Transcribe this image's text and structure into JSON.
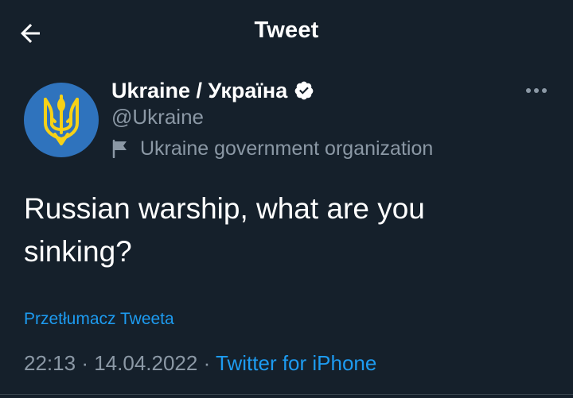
{
  "header": {
    "title": "Tweet",
    "back_icon": "arrow-left-icon"
  },
  "tweet": {
    "author": {
      "display_name": "Ukraine / Україна",
      "handle": "@Ukraine",
      "verified": true,
      "affiliation_label": "Ukraine government organization",
      "avatar_icon": "trident-coat-of-arms-icon"
    },
    "text_line1": "Russian warship, what are you",
    "text_line2": "sinking?",
    "translate_link": "Przetłumacz Tweeta",
    "time": "22:13",
    "separator": "·",
    "date": "14.04.2022",
    "source": "Twitter for iPhone"
  },
  "colors": {
    "background": "#15202b",
    "text_primary": "#ffffff",
    "text_secondary": "#8b98a5",
    "accent": "#1d9bf0",
    "avatar_blue": "#2f73bd",
    "trident_yellow": "#f7d117"
  }
}
